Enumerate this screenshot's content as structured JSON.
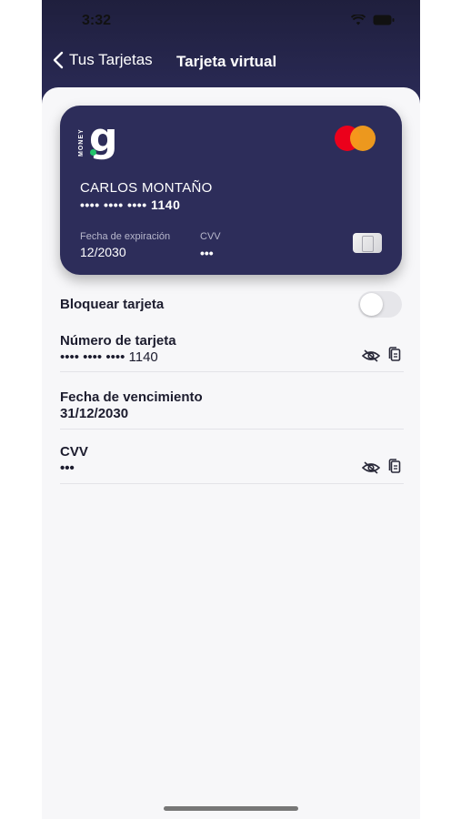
{
  "status": {
    "time": "3:32"
  },
  "nav": {
    "back_label": "Tus Tarjetas",
    "title": "Tarjeta virtual"
  },
  "card": {
    "brand_small": "MONEY",
    "brand_letter": "g",
    "holder": "CARLOS MONTAÑO",
    "number": "•••• •••• •••• 1140",
    "expiration_label": "Fecha de expiración",
    "expiration_value": "12/2030",
    "cvv_label": "CVV",
    "cvv_value": "•••",
    "network_icon": "mastercard-icon"
  },
  "settings": {
    "block_label": "Bloquear tarjeta",
    "block_enabled": false,
    "card_number_label": "Número de tarjeta",
    "card_number_value": "•••• •••• •••• 1140",
    "expiry_label": "Fecha de vencimiento",
    "expiry_value": "31/12/2030",
    "cvv_label": "CVV",
    "cvv_value": "•••"
  },
  "colors": {
    "header": "#1f1f3d",
    "card": "#2d2d5a",
    "accent_green": "#22c36b",
    "mc_red": "#eb001b",
    "mc_orange": "#f79e1b"
  }
}
